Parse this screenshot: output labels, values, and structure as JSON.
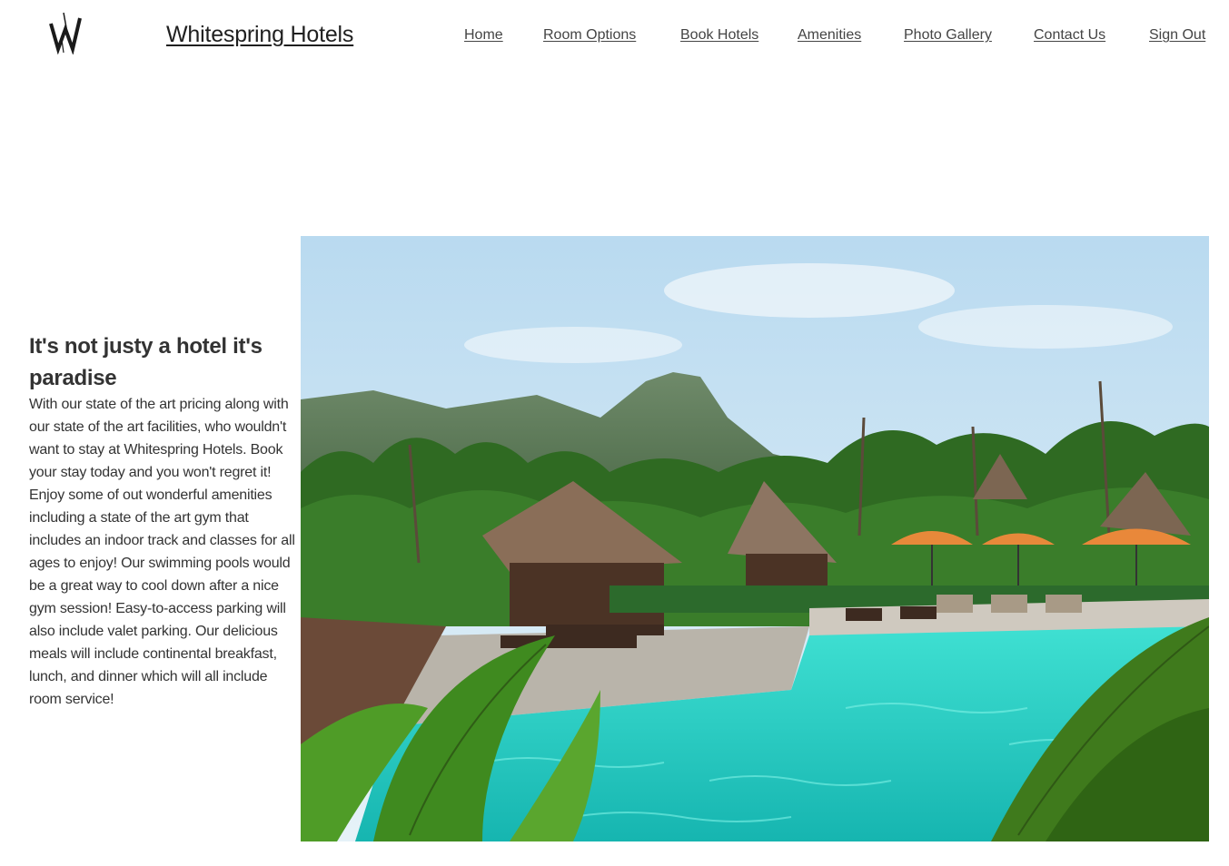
{
  "header": {
    "logo_icon": "w-logo-icon",
    "brand": "Whitespring Hotels"
  },
  "nav": {
    "items": [
      {
        "label": "Home"
      },
      {
        "label": "Room Options"
      },
      {
        "label": "Book Hotels"
      },
      {
        "label": "Amenities"
      },
      {
        "label": "Photo Gallery"
      },
      {
        "label": "Contact Us"
      },
      {
        "label": "Sign Out"
      }
    ]
  },
  "hero": {
    "title": "It's not justy a hotel it's paradise",
    "body": "With our state of the art pricing along with our state of the art facilities, who wouldn't want to stay at Whitespring Hotels. Book your stay today and you won't regret it! Enjoy some of out wonderful amenities including a state of the art gym that includes an indoor track and classes for all ages to enjoy! Our swimming pools would be a great way to cool down after a nice gym session! Easy-to-access parking will also include valet parking. Our delicious meals will include continental breakfast, lunch, and dinner which will all include room service!",
    "image": "tropical-resort-pool-photo"
  },
  "colors": {
    "text": "#333333",
    "sky": "#cfe6f5",
    "pool": "#2fd0c8",
    "foliage": "#2e6b1f"
  }
}
